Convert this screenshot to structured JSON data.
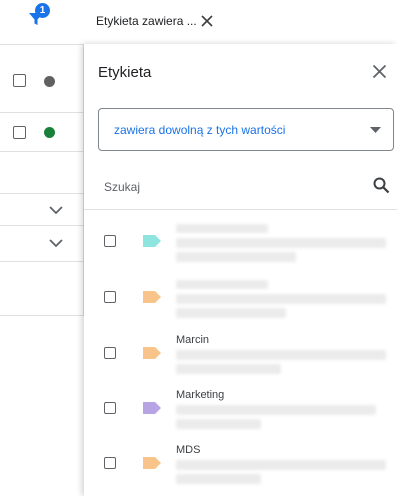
{
  "filter_bar": {
    "badge_count": "1",
    "chip_label": "Etykieta zawiera ..."
  },
  "panel": {
    "title": "Etykieta",
    "condition_value": "zawiera dowolną z tych wartości",
    "search_placeholder": "Szukaj",
    "options": [
      {
        "name": "",
        "tag_color": "#8ee4df"
      },
      {
        "name": "",
        "tag_color": "#f9c48a"
      },
      {
        "name": "Marcin",
        "tag_color": "#f9c48a"
      },
      {
        "name": "Marketing",
        "tag_color": "#b6a4e4"
      },
      {
        "name": "MDS",
        "tag_color": "#f9c48a"
      }
    ]
  },
  "background_rows": {
    "status_dot_colors": [
      "#616161",
      "#188038"
    ]
  },
  "colors": {
    "accent": "#1a73e8"
  }
}
